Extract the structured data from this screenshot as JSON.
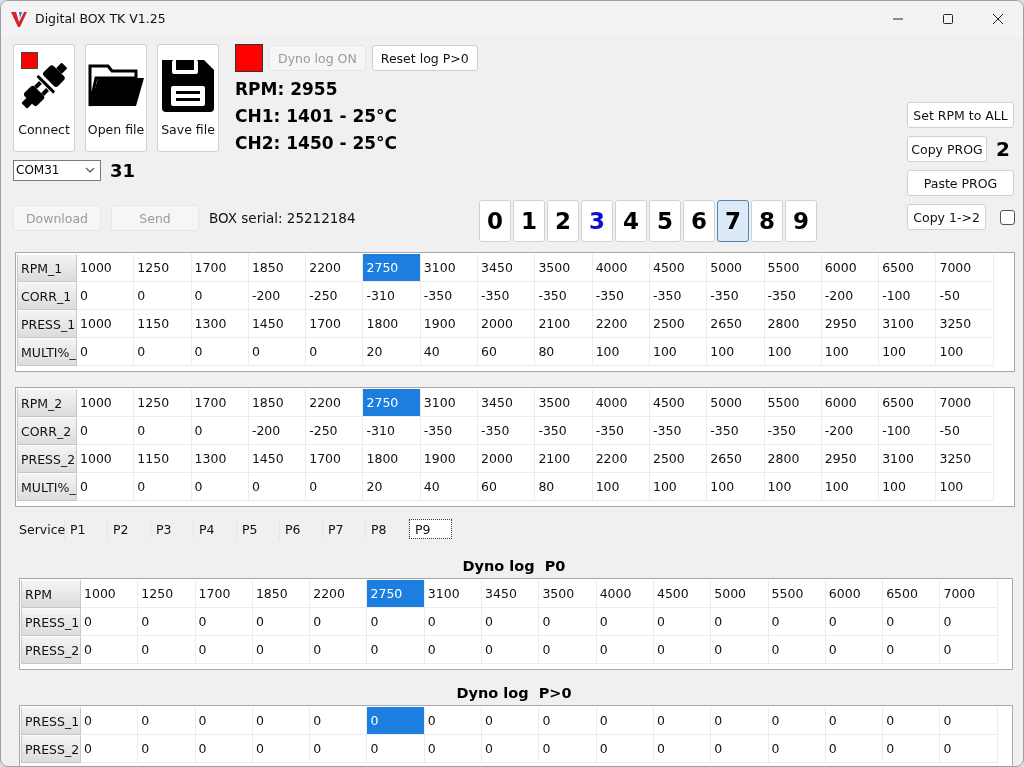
{
  "window": {
    "title": "Digital BOX TK V1.25"
  },
  "file_buttons": [
    {
      "label": "Connect",
      "kind": "connect",
      "connected": false
    },
    {
      "label": "Open file",
      "kind": "open"
    },
    {
      "label": "Save file",
      "kind": "save"
    }
  ],
  "dyno": {
    "logging": false,
    "buttons": [
      {
        "label": "Dyno log ON",
        "disabled": true
      },
      {
        "label": "Reset log P>0",
        "disabled": false
      }
    ]
  },
  "readings": [
    "RPM: 2955",
    "CH1: 1401 - 25°C",
    "CH2: 1450 - 25°C"
  ],
  "port": {
    "value": "COM31",
    "number": "31"
  },
  "transfer_buttons": [
    {
      "label": "Download",
      "disabled": true
    },
    {
      "label": "Send",
      "disabled": true
    }
  ],
  "serial": "BOX serial: 25212184",
  "programs": [
    {
      "label": "0",
      "selected": false,
      "active": false
    },
    {
      "label": "1",
      "selected": false,
      "active": false
    },
    {
      "label": "2",
      "selected": false,
      "active": false
    },
    {
      "label": "3",
      "selected": false,
      "active": true
    },
    {
      "label": "4",
      "selected": false,
      "active": false
    },
    {
      "label": "5",
      "selected": false,
      "active": false
    },
    {
      "label": "6",
      "selected": false,
      "active": false
    },
    {
      "label": "7",
      "selected": true,
      "active": false
    },
    {
      "label": "8",
      "selected": false,
      "active": false
    },
    {
      "label": "9",
      "selected": false,
      "active": false
    }
  ],
  "side": {
    "set_rpm": "Set RPM to ALL",
    "copy_prog": "Copy PROG",
    "copy_target": "2",
    "paste_prog": "Paste PROG",
    "copy_1_2": "Copy 1->2",
    "copy_checkbox": {
      "checked": false
    }
  },
  "tables": [
    {
      "rows": [
        {
          "label": "RPM_1",
          "cells": [
            {
              "text": "1000",
              "selected": false
            },
            {
              "text": "1250",
              "selected": false
            },
            {
              "text": "1700",
              "selected": false
            },
            {
              "text": "1850",
              "selected": false
            },
            {
              "text": "2200",
              "selected": false
            },
            {
              "text": "2750",
              "selected": true
            },
            {
              "text": "3100",
              "selected": false
            },
            {
              "text": "3450",
              "selected": false
            },
            {
              "text": "3500",
              "selected": false
            },
            {
              "text": "4000",
              "selected": false
            },
            {
              "text": "4500",
              "selected": false
            },
            {
              "text": "5000",
              "selected": false
            },
            {
              "text": "5500",
              "selected": false
            },
            {
              "text": "6000",
              "selected": false
            },
            {
              "text": "6500",
              "selected": false
            },
            {
              "text": "7000",
              "selected": false
            }
          ]
        },
        {
          "label": "CORR_1",
          "cells": [
            {
              "text": "0",
              "selected": false
            },
            {
              "text": "0",
              "selected": false
            },
            {
              "text": "0",
              "selected": false
            },
            {
              "text": "-200",
              "selected": false
            },
            {
              "text": "-250",
              "selected": false
            },
            {
              "text": "-310",
              "selected": false
            },
            {
              "text": "-350",
              "selected": false
            },
            {
              "text": "-350",
              "selected": false
            },
            {
              "text": "-350",
              "selected": false
            },
            {
              "text": "-350",
              "selected": false
            },
            {
              "text": "-350",
              "selected": false
            },
            {
              "text": "-350",
              "selected": false
            },
            {
              "text": "-350",
              "selected": false
            },
            {
              "text": "-200",
              "selected": false
            },
            {
              "text": "-100",
              "selected": false
            },
            {
              "text": "-50",
              "selected": false
            }
          ]
        },
        {
          "label": "PRESS_1",
          "cells": [
            {
              "text": "1000",
              "selected": false
            },
            {
              "text": "1150",
              "selected": false
            },
            {
              "text": "1300",
              "selected": false
            },
            {
              "text": "1450",
              "selected": false
            },
            {
              "text": "1700",
              "selected": false
            },
            {
              "text": "1800",
              "selected": false
            },
            {
              "text": "1900",
              "selected": false
            },
            {
              "text": "2000",
              "selected": false
            },
            {
              "text": "2100",
              "selected": false
            },
            {
              "text": "2200",
              "selected": false
            },
            {
              "text": "2500",
              "selected": false
            },
            {
              "text": "2650",
              "selected": false
            },
            {
              "text": "2800",
              "selected": false
            },
            {
              "text": "2950",
              "selected": false
            },
            {
              "text": "3100",
              "selected": false
            },
            {
              "text": "3250",
              "selected": false
            }
          ]
        },
        {
          "label": "MULTI%_",
          "cells": [
            {
              "text": "0",
              "selected": false
            },
            {
              "text": "0",
              "selected": false
            },
            {
              "text": "0",
              "selected": false
            },
            {
              "text": "0",
              "selected": false
            },
            {
              "text": "0",
              "selected": false
            },
            {
              "text": "20",
              "selected": false
            },
            {
              "text": "40",
              "selected": false
            },
            {
              "text": "60",
              "selected": false
            },
            {
              "text": "80",
              "selected": false
            },
            {
              "text": "100",
              "selected": false
            },
            {
              "text": "100",
              "selected": false
            },
            {
              "text": "100",
              "selected": false
            },
            {
              "text": "100",
              "selected": false
            },
            {
              "text": "100",
              "selected": false
            },
            {
              "text": "100",
              "selected": false
            },
            {
              "text": "100",
              "selected": false
            }
          ]
        }
      ]
    },
    {
      "rows": [
        {
          "label": "RPM_2",
          "cells": [
            {
              "text": "1000",
              "selected": false
            },
            {
              "text": "1250",
              "selected": false
            },
            {
              "text": "1700",
              "selected": false
            },
            {
              "text": "1850",
              "selected": false
            },
            {
              "text": "2200",
              "selected": false
            },
            {
              "text": "2750",
              "selected": true
            },
            {
              "text": "3100",
              "selected": false
            },
            {
              "text": "3450",
              "selected": false
            },
            {
              "text": "3500",
              "selected": false
            },
            {
              "text": "4000",
              "selected": false
            },
            {
              "text": "4500",
              "selected": false
            },
            {
              "text": "5000",
              "selected": false
            },
            {
              "text": "5500",
              "selected": false
            },
            {
              "text": "6000",
              "selected": false
            },
            {
              "text": "6500",
              "selected": false
            },
            {
              "text": "7000",
              "selected": false
            }
          ]
        },
        {
          "label": "CORR_2",
          "cells": [
            {
              "text": "0",
              "selected": false
            },
            {
              "text": "0",
              "selected": false
            },
            {
              "text": "0",
              "selected": false
            },
            {
              "text": "-200",
              "selected": false
            },
            {
              "text": "-250",
              "selected": false
            },
            {
              "text": "-310",
              "selected": false
            },
            {
              "text": "-350",
              "selected": false
            },
            {
              "text": "-350",
              "selected": false
            },
            {
              "text": "-350",
              "selected": false
            },
            {
              "text": "-350",
              "selected": false
            },
            {
              "text": "-350",
              "selected": false
            },
            {
              "text": "-350",
              "selected": false
            },
            {
              "text": "-350",
              "selected": false
            },
            {
              "text": "-200",
              "selected": false
            },
            {
              "text": "-100",
              "selected": false
            },
            {
              "text": "-50",
              "selected": false
            }
          ]
        },
        {
          "label": "PRESS_2",
          "cells": [
            {
              "text": "1000",
              "selected": false
            },
            {
              "text": "1150",
              "selected": false
            },
            {
              "text": "1300",
              "selected": false
            },
            {
              "text": "1450",
              "selected": false
            },
            {
              "text": "1700",
              "selected": false
            },
            {
              "text": "1800",
              "selected": false
            },
            {
              "text": "1900",
              "selected": false
            },
            {
              "text": "2000",
              "selected": false
            },
            {
              "text": "2100",
              "selected": false
            },
            {
              "text": "2200",
              "selected": false
            },
            {
              "text": "2500",
              "selected": false
            },
            {
              "text": "2650",
              "selected": false
            },
            {
              "text": "2800",
              "selected": false
            },
            {
              "text": "2950",
              "selected": false
            },
            {
              "text": "3100",
              "selected": false
            },
            {
              "text": "3250",
              "selected": false
            }
          ]
        },
        {
          "label": "MULTI%_",
          "cells": [
            {
              "text": "0",
              "selected": false
            },
            {
              "text": "0",
              "selected": false
            },
            {
              "text": "0",
              "selected": false
            },
            {
              "text": "0",
              "selected": false
            },
            {
              "text": "0",
              "selected": false
            },
            {
              "text": "20",
              "selected": false
            },
            {
              "text": "40",
              "selected": false
            },
            {
              "text": "60",
              "selected": false
            },
            {
              "text": "80",
              "selected": false
            },
            {
              "text": "100",
              "selected": false
            },
            {
              "text": "100",
              "selected": false
            },
            {
              "text": "100",
              "selected": false
            },
            {
              "text": "100",
              "selected": false
            },
            {
              "text": "100",
              "selected": false
            },
            {
              "text": "100",
              "selected": false
            },
            {
              "text": "100",
              "selected": false
            }
          ]
        }
      ]
    }
  ],
  "tabs": [
    {
      "label": "Service",
      "selected": false
    },
    {
      "label": "P1",
      "selected": false
    },
    {
      "label": "P2",
      "selected": false
    },
    {
      "label": "P3",
      "selected": false
    },
    {
      "label": "P4",
      "selected": false
    },
    {
      "label": "P5",
      "selected": false
    },
    {
      "label": "P6",
      "selected": false
    },
    {
      "label": "P7",
      "selected": false
    },
    {
      "label": "P8",
      "selected": false
    },
    {
      "label": "P9",
      "selected": true
    }
  ],
  "dyno_tables": [
    {
      "title": "Dyno log  P0",
      "rows": [
        {
          "label": "RPM",
          "cells": [
            {
              "text": "1000",
              "selected": false
            },
            {
              "text": "1250",
              "selected": false
            },
            {
              "text": "1700",
              "selected": false
            },
            {
              "text": "1850",
              "selected": false
            },
            {
              "text": "2200",
              "selected": false
            },
            {
              "text": "2750",
              "selected": true
            },
            {
              "text": "3100",
              "selected": false
            },
            {
              "text": "3450",
              "selected": false
            },
            {
              "text": "3500",
              "selected": false
            },
            {
              "text": "4000",
              "selected": false
            },
            {
              "text": "4500",
              "selected": false
            },
            {
              "text": "5000",
              "selected": false
            },
            {
              "text": "5500",
              "selected": false
            },
            {
              "text": "6000",
              "selected": false
            },
            {
              "text": "6500",
              "selected": false
            },
            {
              "text": "7000",
              "selected": false
            }
          ]
        },
        {
          "label": "PRESS_1",
          "cells": [
            {
              "text": "0",
              "selected": false
            },
            {
              "text": "0",
              "selected": false
            },
            {
              "text": "0",
              "selected": false
            },
            {
              "text": "0",
              "selected": false
            },
            {
              "text": "0",
              "selected": false
            },
            {
              "text": "0",
              "selected": false
            },
            {
              "text": "0",
              "selected": false
            },
            {
              "text": "0",
              "selected": false
            },
            {
              "text": "0",
              "selected": false
            },
            {
              "text": "0",
              "selected": false
            },
            {
              "text": "0",
              "selected": false
            },
            {
              "text": "0",
              "selected": false
            },
            {
              "text": "0",
              "selected": false
            },
            {
              "text": "0",
              "selected": false
            },
            {
              "text": "0",
              "selected": false
            },
            {
              "text": "0",
              "selected": false
            }
          ]
        },
        {
          "label": "PRESS_2",
          "cells": [
            {
              "text": "0",
              "selected": false
            },
            {
              "text": "0",
              "selected": false
            },
            {
              "text": "0",
              "selected": false
            },
            {
              "text": "0",
              "selected": false
            },
            {
              "text": "0",
              "selected": false
            },
            {
              "text": "0",
              "selected": false
            },
            {
              "text": "0",
              "selected": false
            },
            {
              "text": "0",
              "selected": false
            },
            {
              "text": "0",
              "selected": false
            },
            {
              "text": "0",
              "selected": false
            },
            {
              "text": "0",
              "selected": false
            },
            {
              "text": "0",
              "selected": false
            },
            {
              "text": "0",
              "selected": false
            },
            {
              "text": "0",
              "selected": false
            },
            {
              "text": "0",
              "selected": false
            },
            {
              "text": "0",
              "selected": false
            }
          ]
        }
      ]
    },
    {
      "title": "Dyno log  P>0",
      "rows": [
        {
          "label": "PRESS_1",
          "cells": [
            {
              "text": "0",
              "selected": false
            },
            {
              "text": "0",
              "selected": false
            },
            {
              "text": "0",
              "selected": false
            },
            {
              "text": "0",
              "selected": false
            },
            {
              "text": "0",
              "selected": false
            },
            {
              "text": "0",
              "selected": true
            },
            {
              "text": "0",
              "selected": false
            },
            {
              "text": "0",
              "selected": false
            },
            {
              "text": "0",
              "selected": false
            },
            {
              "text": "0",
              "selected": false
            },
            {
              "text": "0",
              "selected": false
            },
            {
              "text": "0",
              "selected": false
            },
            {
              "text": "0",
              "selected": false
            },
            {
              "text": "0",
              "selected": false
            },
            {
              "text": "0",
              "selected": false
            },
            {
              "text": "0",
              "selected": false
            }
          ]
        },
        {
          "label": "PRESS_2",
          "cells": [
            {
              "text": "0",
              "selected": false
            },
            {
              "text": "0",
              "selected": false
            },
            {
              "text": "0",
              "selected": false
            },
            {
              "text": "0",
              "selected": false
            },
            {
              "text": "0",
              "selected": false
            },
            {
              "text": "0",
              "selected": false
            },
            {
              "text": "0",
              "selected": false
            },
            {
              "text": "0",
              "selected": false
            },
            {
              "text": "0",
              "selected": false
            },
            {
              "text": "0",
              "selected": false
            },
            {
              "text": "0",
              "selected": false
            },
            {
              "text": "0",
              "selected": false
            },
            {
              "text": "0",
              "selected": false
            },
            {
              "text": "0",
              "selected": false
            },
            {
              "text": "0",
              "selected": false
            },
            {
              "text": "0",
              "selected": false
            }
          ]
        }
      ]
    }
  ]
}
